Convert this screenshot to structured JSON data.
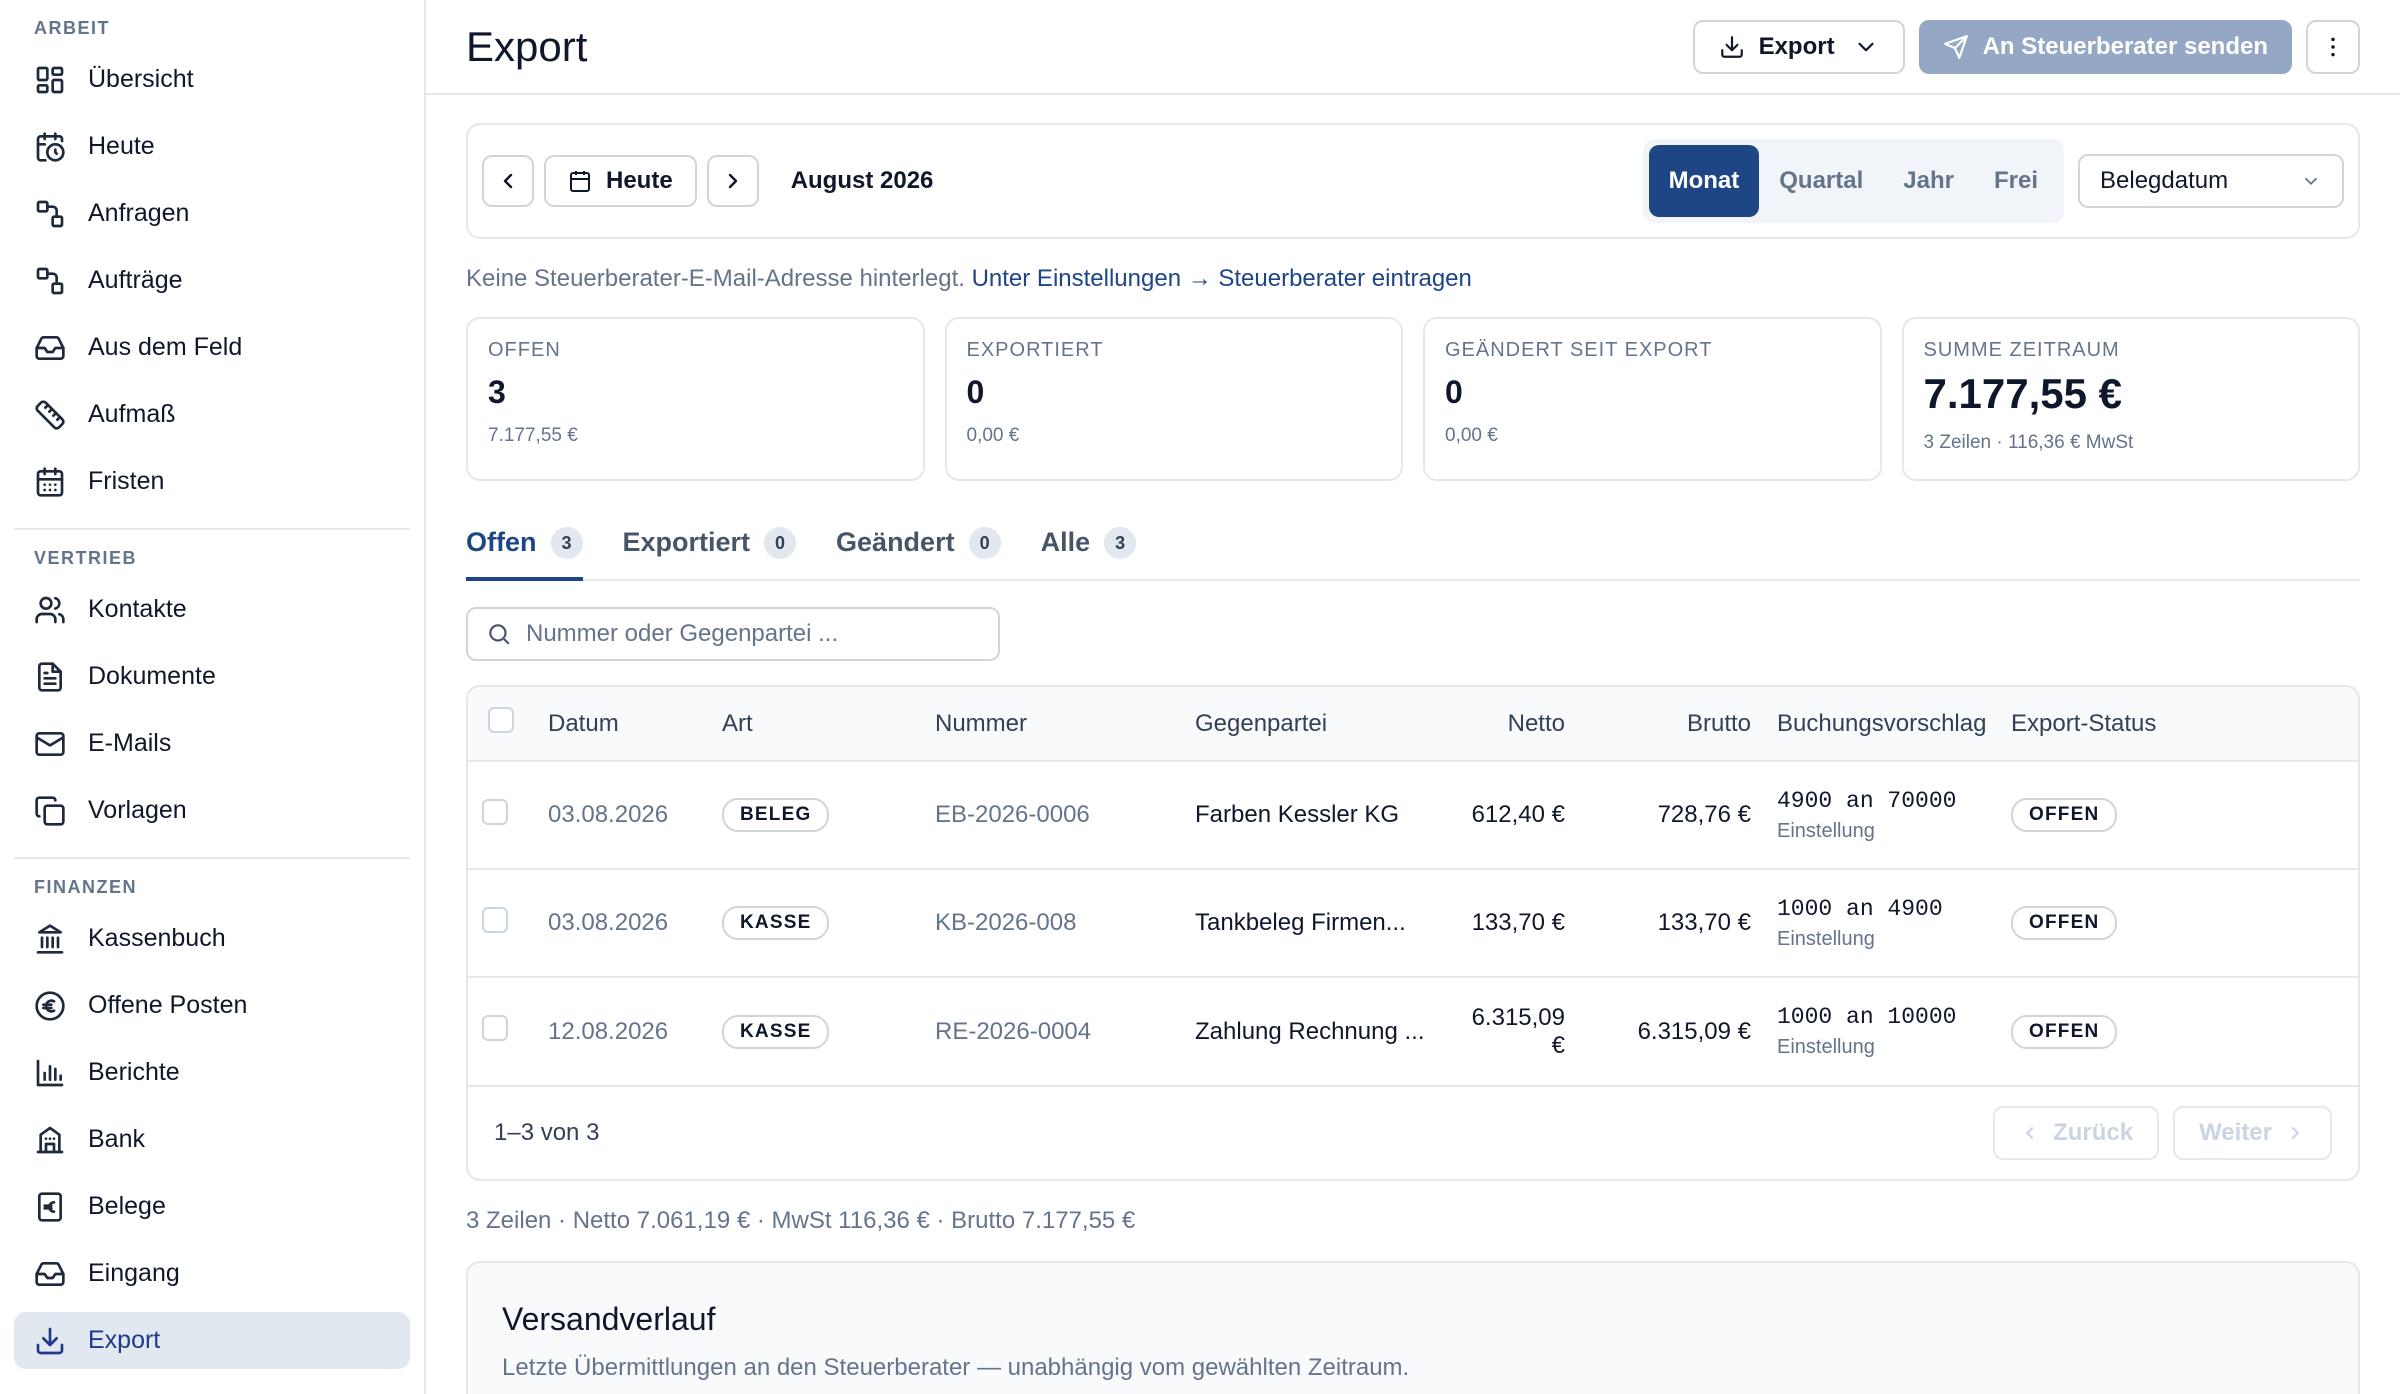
{
  "sidebar": {
    "sections": [
      {
        "title": "ARBEIT",
        "items": [
          {
            "label": "Übersicht",
            "icon": "grid-icon"
          },
          {
            "label": "Heute",
            "icon": "clock-calendar-icon"
          },
          {
            "label": "Anfragen",
            "icon": "route-icon"
          },
          {
            "label": "Aufträge",
            "icon": "route-icon"
          },
          {
            "label": "Aus dem Feld",
            "icon": "inbox-icon"
          },
          {
            "label": "Aufmaß",
            "icon": "ruler-icon"
          },
          {
            "label": "Fristen",
            "icon": "calendar-icon"
          }
        ]
      },
      {
        "title": "VERTRIEB",
        "items": [
          {
            "label": "Kontakte",
            "icon": "users-icon"
          },
          {
            "label": "Dokumente",
            "icon": "document-icon"
          },
          {
            "label": "E-Mails",
            "icon": "mail-icon"
          },
          {
            "label": "Vorlagen",
            "icon": "copy-icon"
          }
        ]
      },
      {
        "title": "FINANZEN",
        "items": [
          {
            "label": "Kassenbuch",
            "icon": "bank-icon"
          },
          {
            "label": "Offene Posten",
            "icon": "euro-circle-icon"
          },
          {
            "label": "Berichte",
            "icon": "bar-chart-icon"
          },
          {
            "label": "Bank",
            "icon": "building-icon"
          },
          {
            "label": "Belege",
            "icon": "euro-receipt-icon"
          },
          {
            "label": "Eingang",
            "icon": "inbox-icon"
          },
          {
            "label": "Export",
            "icon": "download-icon",
            "active": true
          }
        ]
      }
    ]
  },
  "header": {
    "title": "Export",
    "export_label": "Export",
    "send_label": "An Steuerberater senden"
  },
  "period": {
    "today_label": "Heute",
    "current": "August 2026",
    "segments": [
      "Monat",
      "Quartal",
      "Jahr",
      "Frei"
    ],
    "active_segment": "Monat",
    "date_field": "Belegdatum"
  },
  "hint": {
    "text": "Keine Steuerberater-E-Mail-Adresse hinterlegt.",
    "link": "Unter Einstellungen → Steuerberater eintragen"
  },
  "stats": [
    {
      "label": "OFFEN",
      "value": "3",
      "sub": "7.177,55 €"
    },
    {
      "label": "EXPORTIERT",
      "value": "0",
      "sub": "0,00 €"
    },
    {
      "label": "GEÄNDERT SEIT EXPORT",
      "value": "0",
      "sub": "0,00 €"
    },
    {
      "label": "SUMME ZEITRAUM",
      "value": "7.177,55 €",
      "sub": "3 Zeilen · 116,36 € MwSt"
    }
  ],
  "tabs": [
    {
      "label": "Offen",
      "count": "3",
      "active": true
    },
    {
      "label": "Exportiert",
      "count": "0"
    },
    {
      "label": "Geändert",
      "count": "0"
    },
    {
      "label": "Alle",
      "count": "3"
    }
  ],
  "search": {
    "placeholder": "Nummer oder Gegenpartei ..."
  },
  "table": {
    "headers": [
      "Datum",
      "Art",
      "Nummer",
      "Gegenpartei",
      "Netto",
      "Brutto",
      "Buchungsvorschlag",
      "Export-Status"
    ],
    "rows": [
      {
        "datum": "03.08.2026",
        "art": "BELEG",
        "nummer": "EB-2026-0006",
        "gegenpartei": "Farben Kessler KG",
        "netto": "612,40 €",
        "brutto": "728,76 €",
        "buchung": "4900 an 70000",
        "buchung_sub": "Einstellung",
        "status": "OFFEN"
      },
      {
        "datum": "03.08.2026",
        "art": "KASSE",
        "nummer": "KB-2026-008",
        "gegenpartei": "Tankbeleg Firmen...",
        "netto": "133,70 €",
        "brutto": "133,70 €",
        "buchung": "1000 an 4900",
        "buchung_sub": "Einstellung",
        "status": "OFFEN"
      },
      {
        "datum": "12.08.2026",
        "art": "KASSE",
        "nummer": "RE-2026-0004",
        "gegenpartei": "Zahlung Rechnung ...",
        "netto": "6.315,09 €",
        "brutto": "6.315,09 €",
        "buchung": "1000 an 10000",
        "buchung_sub": "Einstellung",
        "status": "OFFEN"
      }
    ],
    "range": "1–3 von 3",
    "prev_label": "Zurück",
    "next_label": "Weiter"
  },
  "summary": "3 Zeilen · Netto 7.061,19 € · MwSt 116,36 € · Brutto 7.177,55 €",
  "versand": {
    "title": "Versandverlauf",
    "subtitle": "Letzte Übermittlungen an den Steuerberater — unabhängig vom gewählten Zeitraum."
  }
}
